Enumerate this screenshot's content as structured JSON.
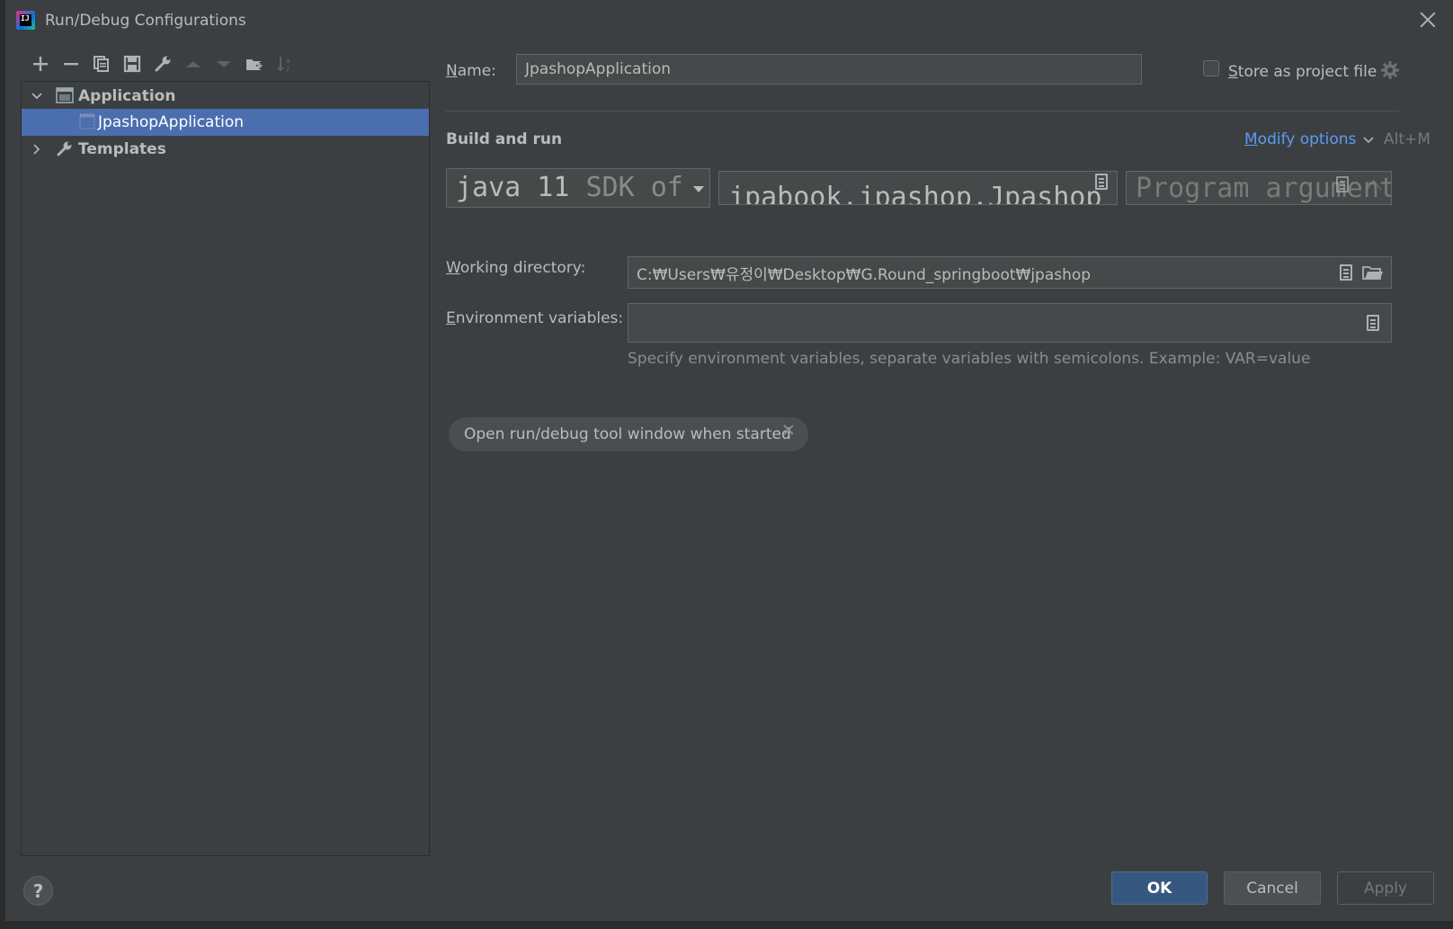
{
  "window": {
    "title": "Run/Debug Configurations",
    "app_icon_text": "IJ"
  },
  "toolbar": {
    "buttons": [
      "add-icon",
      "remove-icon",
      "copy-icon",
      "save-icon",
      "wrench-icon",
      "move-up-icon",
      "move-down-icon",
      "new-folder-icon",
      "sort-icon"
    ]
  },
  "tree": {
    "group_application": "Application",
    "item_selected": "JpashopApplication",
    "group_templates": "Templates"
  },
  "form": {
    "name_label_mnemonic": "N",
    "name_label_rest": "ame:",
    "name_value": "JpashopApplication",
    "store_label_mnemonic": "S",
    "store_label_rest": "tore as project file",
    "store_checked": false,
    "section_title": "Build and run",
    "modify_options_mnemonic": "M",
    "modify_options_rest": "odify options",
    "modify_options_shortcut": "Alt+M",
    "sdk_main": "java 11",
    "sdk_muted": " SDK of",
    "main_class": "jpabook.jpashop.Jpashop",
    "program_args_placeholder": "Program arguments",
    "workdir_label_mnemonic": "W",
    "workdir_label_rest": "orking directory:",
    "workdir_value": "C:₩Users₩유정이₩Desktop₩G.Round_springboot₩jpashop",
    "env_label_mnemonic": "E",
    "env_label_rest": "nvironment variables:",
    "env_value": "",
    "env_hint": "Specify environment variables, separate variables with semicolons. Example: VAR=value",
    "option_tag": "Open run/debug tool window when started"
  },
  "footer": {
    "help": "?",
    "ok": "OK",
    "cancel": "Cancel",
    "apply": "Apply"
  },
  "colors": {
    "background": "#3c3f41",
    "selection": "#4b6eaf",
    "link": "#589df6",
    "ok_button": "#365880"
  }
}
